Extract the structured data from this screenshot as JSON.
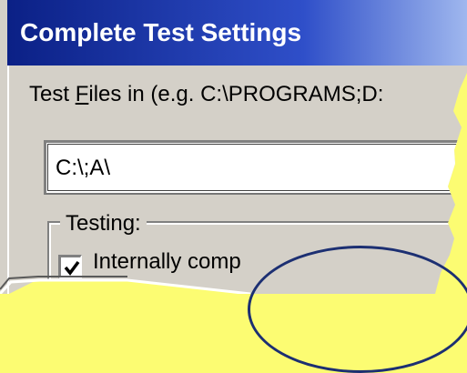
{
  "window": {
    "title": "Complete Test Settings"
  },
  "files": {
    "label_prefix": "Test ",
    "label_mnemonic": "F",
    "label_suffix": "iles in (e.g. C:\\PROGRAMS;D:",
    "path_value": "C:\\;A\\"
  },
  "testing_group": {
    "legend": "Testing:",
    "internal_checkbox": {
      "label": "Internally comp",
      "checked": true
    }
  },
  "colors": {
    "background": "#fcfc72",
    "title_bar": "#0a1f84",
    "dialog_face": "#d4d0c8"
  }
}
